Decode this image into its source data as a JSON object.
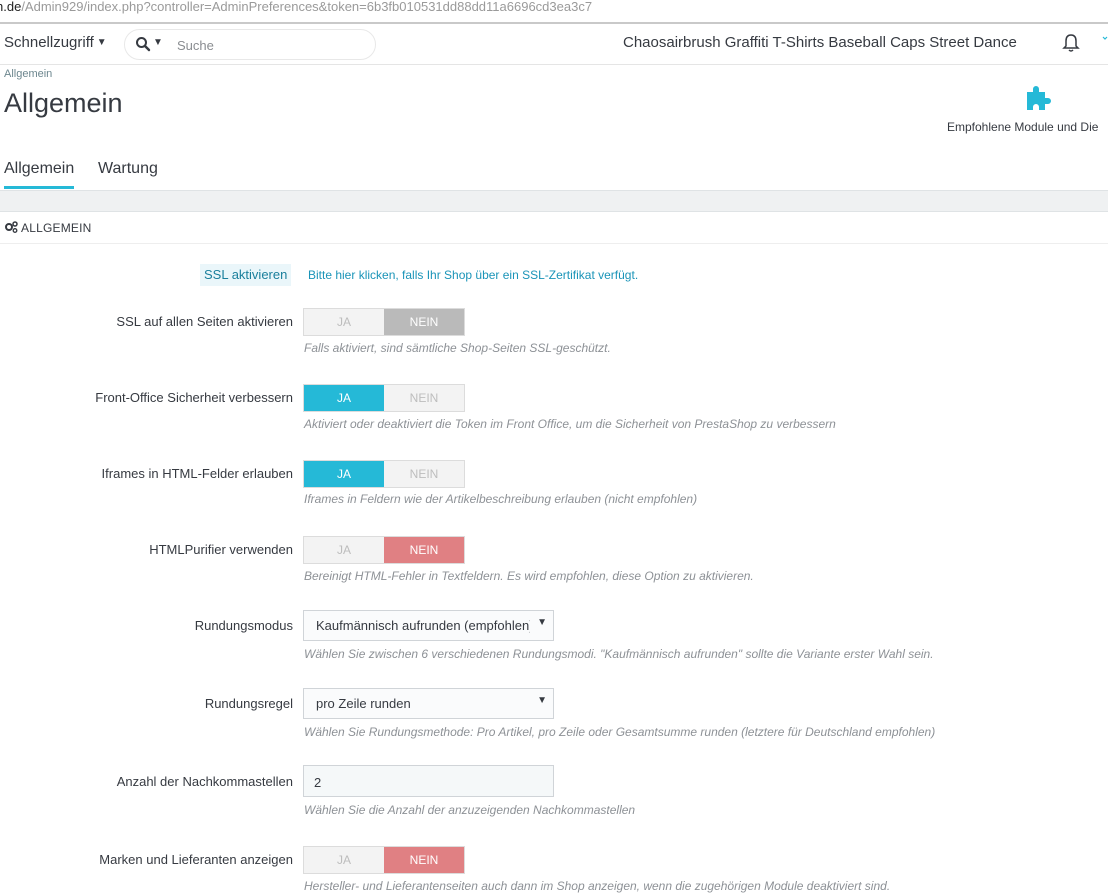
{
  "browser": {
    "url_host": "n.de",
    "url_path": "/Admin929/index.php?controller=AdminPreferences&token=6b3fb010531dd88dd11a6696cd3ea3c7"
  },
  "header": {
    "quick_access": "Schnellzugriff",
    "search_placeholder": "Suche",
    "shop_name": "Chaosairbrush Graffiti T-Shirts Baseball Caps Street Dance"
  },
  "page": {
    "breadcrumb": "Allgemein",
    "title": "Allgemein",
    "toolbar_label": "Empfohlene Module und Die"
  },
  "tabs": [
    {
      "label": "Allgemein",
      "active": true
    },
    {
      "label": "Wartung",
      "active": false
    }
  ],
  "panel": {
    "title": "ALLGEMEIN"
  },
  "form": {
    "ssl_enable": {
      "button": "SSL aktivieren",
      "link": "Bitte hier klicken, falls Ihr Shop über ein SSL-Zertifikat verfügt."
    },
    "ssl_all": {
      "label": "SSL auf allen Seiten aktivieren",
      "yes": "JA",
      "no": "NEIN",
      "selected": "NEIN",
      "help": "Falls aktiviert, sind sämtliche Shop-Seiten SSL-geschützt."
    },
    "front_security": {
      "label": "Front-Office Sicherheit verbessern",
      "yes": "JA",
      "no": "NEIN",
      "selected": "JA",
      "help": "Aktiviert oder deaktiviert die Token im Front Office, um die Sicherheit von PrestaShop zu verbessern"
    },
    "iframes": {
      "label": "Iframes in HTML-Felder erlauben",
      "yes": "JA",
      "no": "NEIN",
      "selected": "JA",
      "help": "Iframes in Feldern wie der Artikelbeschreibung erlauben (nicht empfohlen)"
    },
    "purifier": {
      "label": "HTMLPurifier verwenden",
      "yes": "JA",
      "no": "NEIN",
      "selected": "NEIN",
      "help": "Bereinigt HTML-Fehler in Textfeldern. Es wird empfohlen, diese Option zu aktivieren."
    },
    "rounding_mode": {
      "label": "Rundungsmodus",
      "value": "Kaufmännisch aufrunden (empfohlen)",
      "help": "Wählen Sie zwischen 6 verschiedenen Rundungsmodi. \"Kaufmännisch aufrunden\" sollte die Variante erster Wahl sein."
    },
    "rounding_rule": {
      "label": "Rundungsregel",
      "value": "pro Zeile runden",
      "help": "Wählen Sie Rundungsmethode: Pro Artikel, pro Zeile oder Gesamtsumme runden (letztere für Deutschland empfohlen)"
    },
    "decimals": {
      "label": "Anzahl der Nachkommastellen",
      "value": "2",
      "help": "Wählen Sie die Anzahl der anzuzeigenden Nachkommastellen"
    },
    "brands": {
      "label": "Marken und Lieferanten anzeigen",
      "yes": "JA",
      "no": "NEIN",
      "selected": "NEIN",
      "help": "Hersteller- und Lieferantenseiten auch dann im Shop anzeigen, wenn die zugehörigen Module deaktiviert sind."
    }
  },
  "colors": {
    "accent": "#25b9d7",
    "switch_no_red": "#e08083",
    "switch_no_gray": "#bababa"
  },
  "icons": [
    "search-icon",
    "bell-icon",
    "puzzle-icon",
    "gears-icon",
    "chevron-down-icon"
  ]
}
